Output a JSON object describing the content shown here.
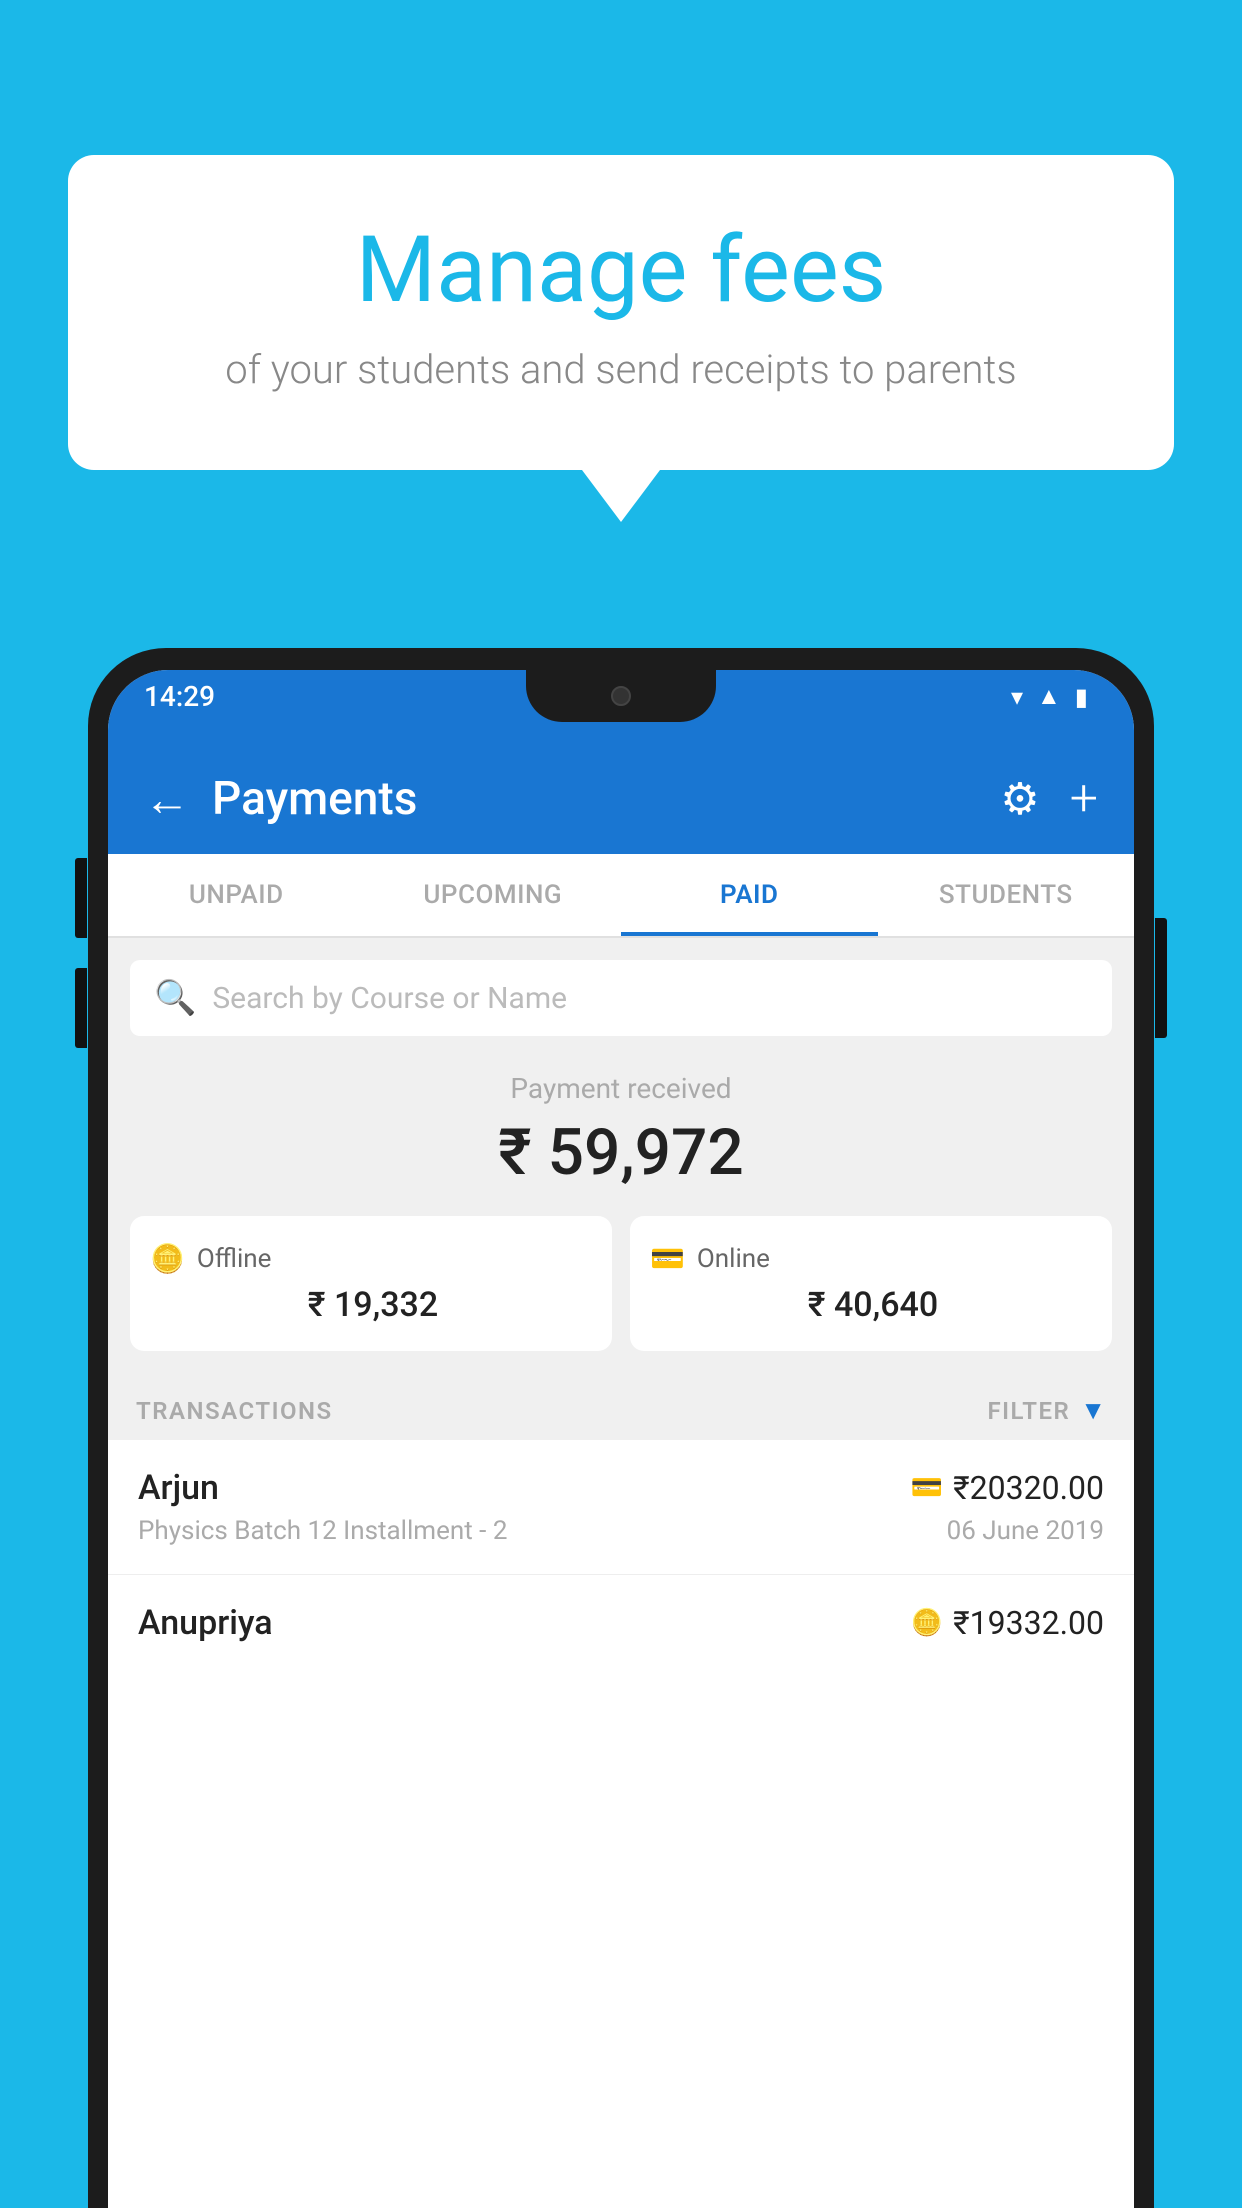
{
  "background_color": "#1bb8e8",
  "speech_bubble": {
    "title": "Manage fees",
    "subtitle": "of your students and send receipts to parents"
  },
  "phone": {
    "status_bar": {
      "time": "14:29",
      "wifi": "▾",
      "signal": "▲",
      "battery": "▮"
    },
    "header": {
      "back_label": "←",
      "title": "Payments",
      "settings_icon": "⚙",
      "add_icon": "+"
    },
    "tabs": [
      {
        "label": "UNPAID",
        "active": false
      },
      {
        "label": "UPCOMING",
        "active": false
      },
      {
        "label": "PAID",
        "active": true
      },
      {
        "label": "STUDENTS",
        "active": false
      }
    ],
    "search": {
      "placeholder": "Search by Course or Name"
    },
    "payment_summary": {
      "label": "Payment received",
      "total": "₹ 59,972",
      "offline": {
        "mode_icon": "💳",
        "label": "Offline",
        "amount": "₹ 19,332"
      },
      "online": {
        "mode_icon": "💳",
        "label": "Online",
        "amount": "₹ 40,640"
      }
    },
    "transactions_section": {
      "header_label": "TRANSACTIONS",
      "filter_label": "FILTER"
    },
    "transactions": [
      {
        "name": "Arjun",
        "course": "Physics Batch 12 Installment - 2",
        "amount": "₹20320.00",
        "date": "06 June 2019",
        "payment_mode": "online"
      },
      {
        "name": "Anupriya",
        "course": "",
        "amount": "₹19332.00",
        "date": "",
        "payment_mode": "offline"
      }
    ]
  }
}
